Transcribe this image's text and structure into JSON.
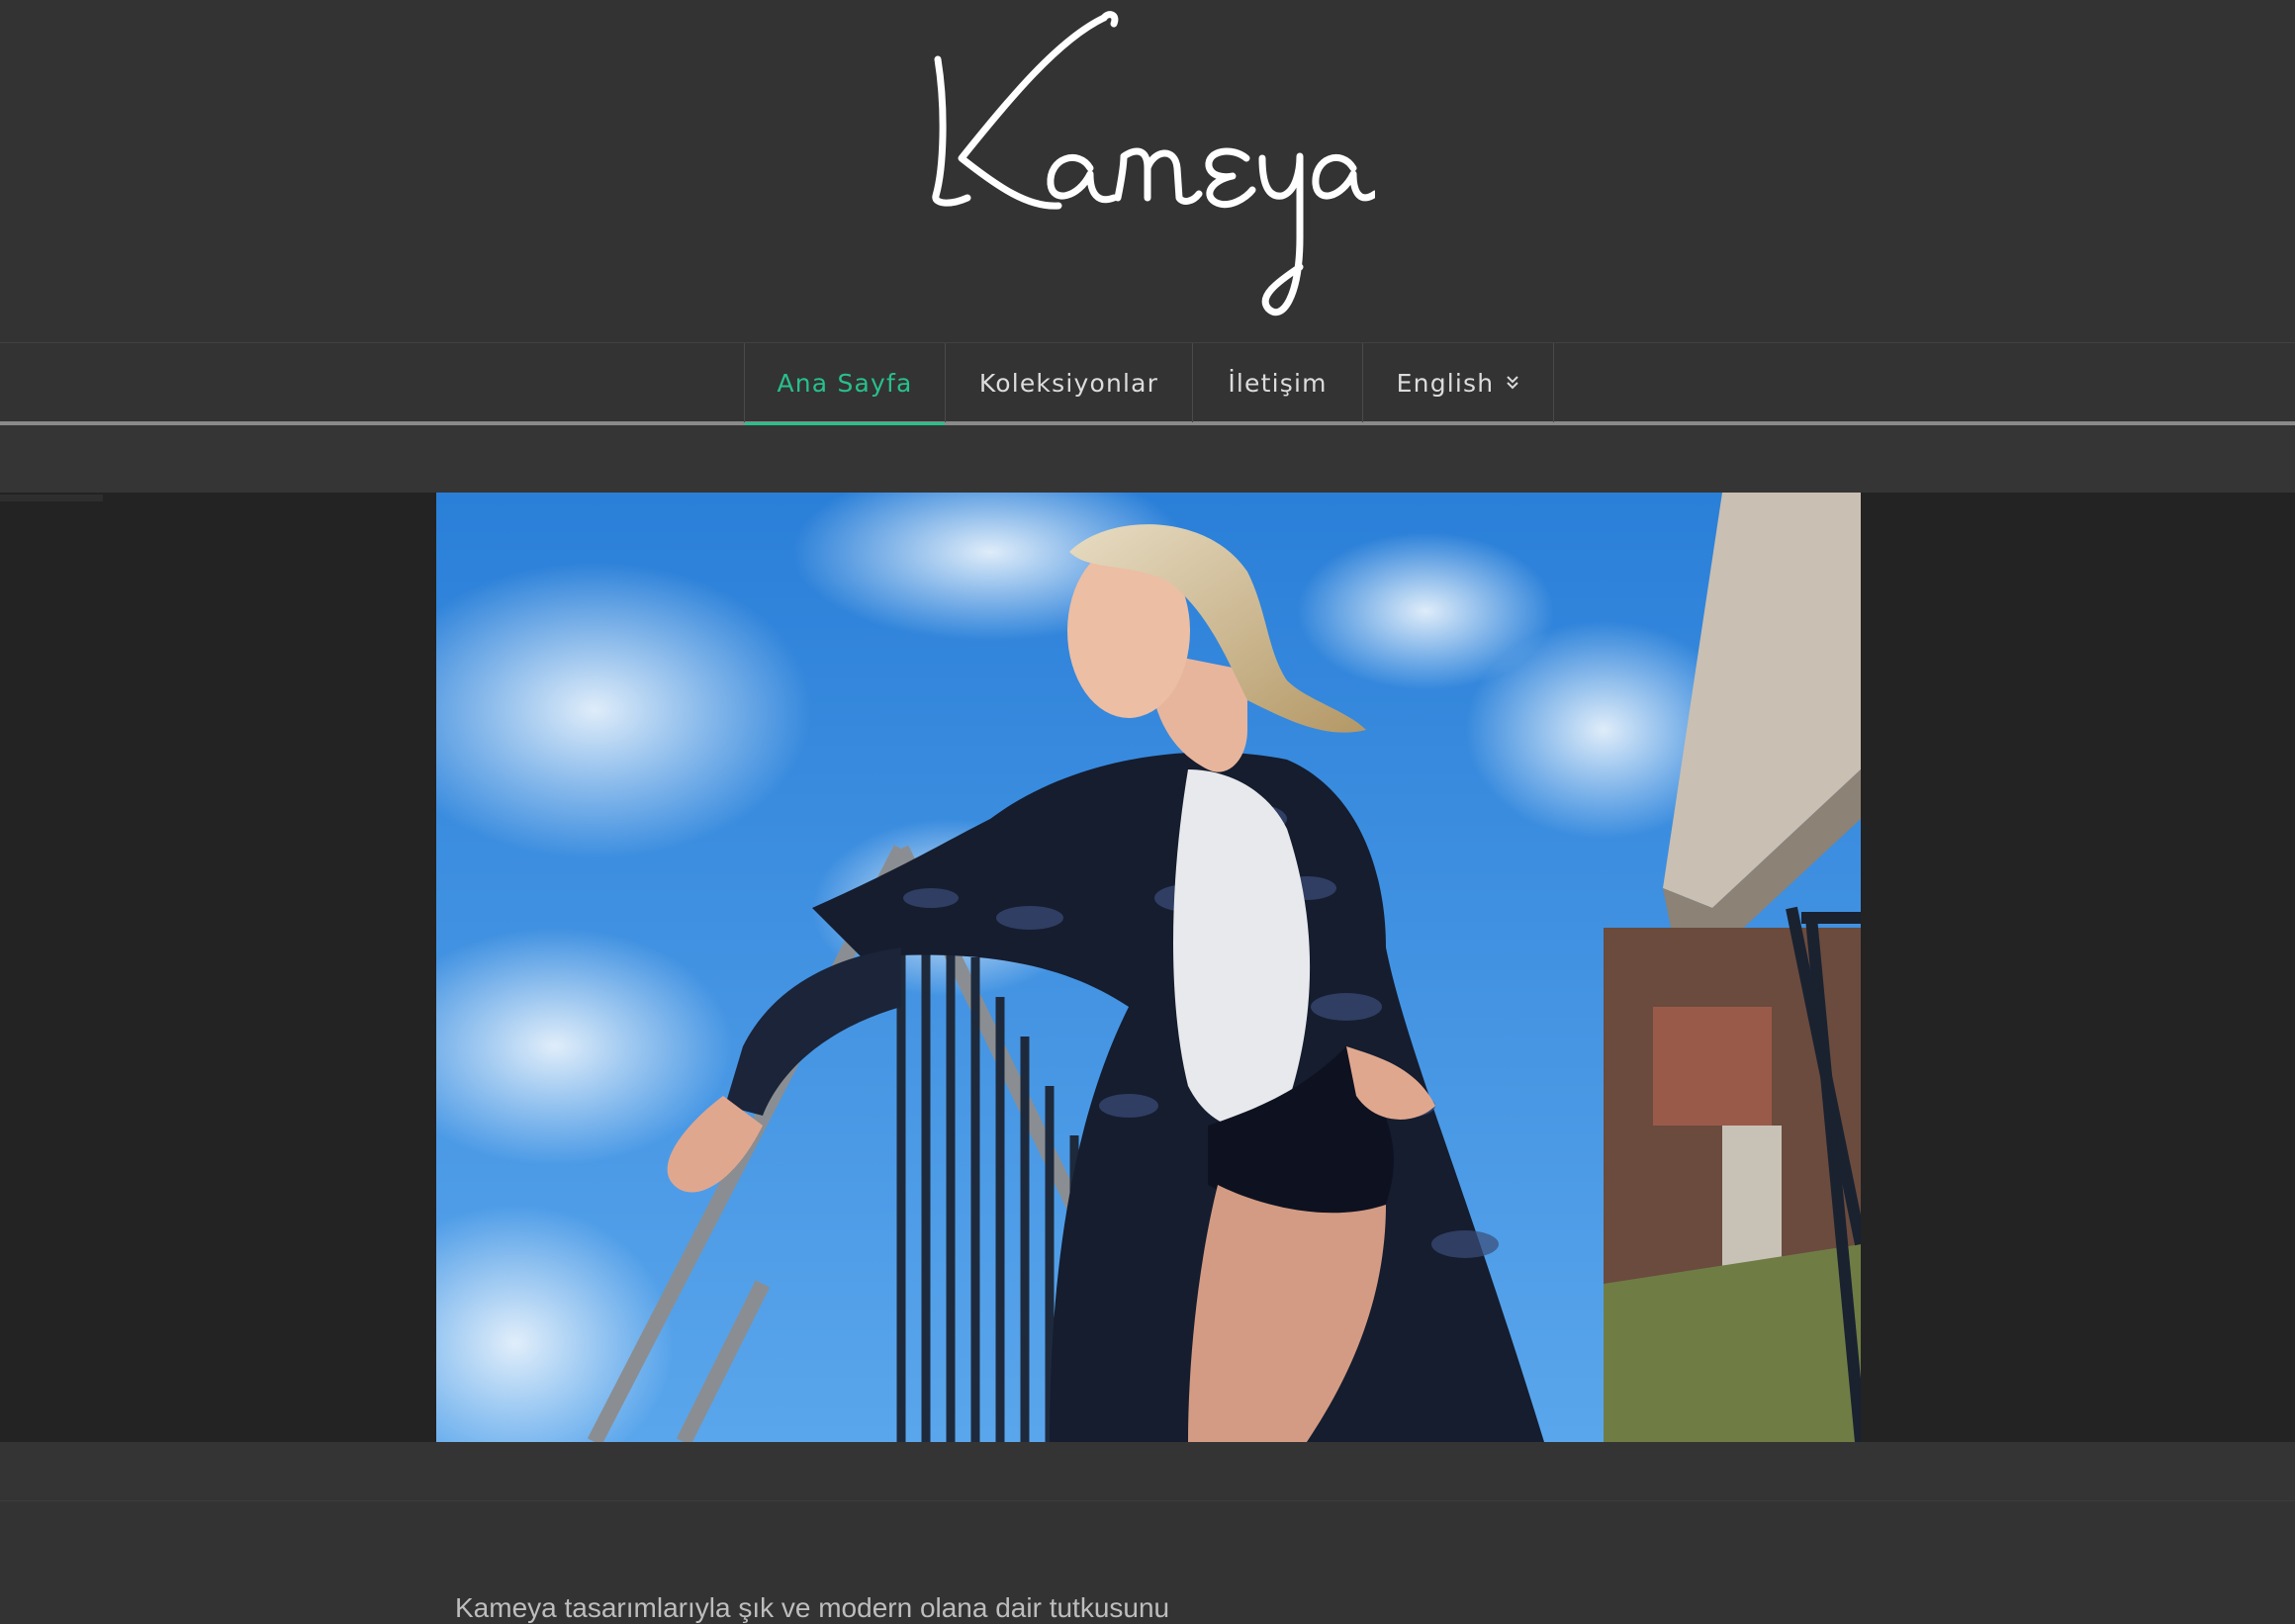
{
  "brand": {
    "logo_text": "Kameya"
  },
  "nav": {
    "items": [
      {
        "label": "Ana Sayfa",
        "active": true
      },
      {
        "label": "Koleksiyonlar",
        "active": false
      },
      {
        "label": "İletişim",
        "active": false
      },
      {
        "label": "English",
        "active": false,
        "has_dropdown": true
      }
    ]
  },
  "hero": {
    "image": "fashion-model-on-stairs"
  },
  "content": {
    "intro": "Kameya tasarımlarıyla şık ve modern olana dair tutkusunu"
  },
  "colors": {
    "accent": "#28c08b",
    "background": "#333333",
    "band": "#232323",
    "text": "#dcdcdc"
  }
}
